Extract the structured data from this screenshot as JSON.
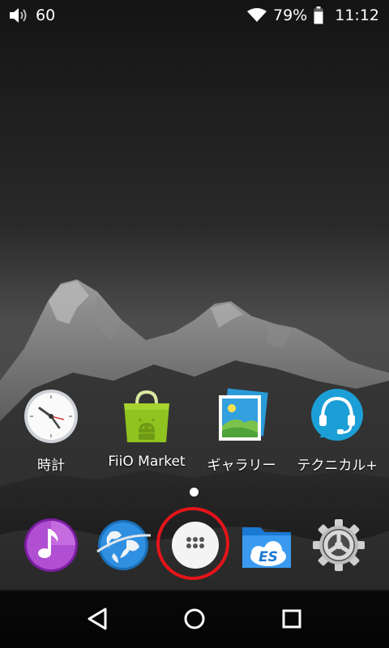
{
  "status_bar": {
    "volume_icon": "volume-icon",
    "volume_level": "60",
    "wifi_icon": "wifi-icon",
    "battery_percent": "79%",
    "battery_icon": "battery-icon",
    "time": "11:12"
  },
  "home": {
    "apps": [
      {
        "label": "時計",
        "icon": "clock-icon"
      },
      {
        "label": "FiiO Market",
        "icon": "market-bag-icon"
      },
      {
        "label": "ギャラリー",
        "icon": "gallery-icon"
      },
      {
        "label": "テクニカル+",
        "icon": "headset-support-icon"
      }
    ],
    "page_indicator": {
      "pages": 1,
      "current": 1
    }
  },
  "dock": {
    "items": [
      {
        "icon": "music-icon"
      },
      {
        "icon": "browser-globe-icon"
      },
      {
        "icon": "app-drawer-icon",
        "highlighted": true
      },
      {
        "icon": "es-file-explorer-icon"
      },
      {
        "icon": "settings-gear-icon"
      }
    ],
    "highlight_color": "#e5141a"
  },
  "nav_bar": {
    "buttons": [
      {
        "icon": "back-icon"
      },
      {
        "icon": "home-icon"
      },
      {
        "icon": "recents-icon"
      }
    ]
  }
}
